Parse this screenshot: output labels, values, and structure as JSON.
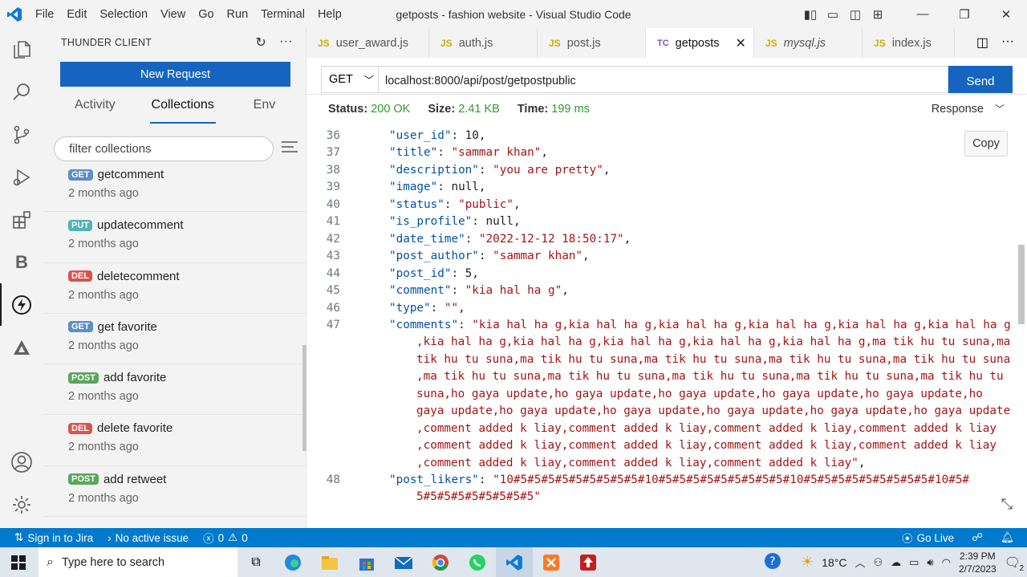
{
  "titlebar": {
    "menu": [
      "File",
      "Edit",
      "Selection",
      "View",
      "Go",
      "Run",
      "Terminal",
      "Help"
    ],
    "title": "getposts - fashion website - Visual Studio Code"
  },
  "activity_bar": [
    "explorer-icon",
    "search-icon",
    "source-control-icon",
    "run-debug-icon",
    "extensions-icon",
    "b-icon",
    "thunder-client-icon",
    "triangle-icon",
    "account-icon",
    "settings-gear-icon"
  ],
  "sidebar": {
    "title": "THUNDER CLIENT",
    "new_request": "New Request",
    "tabs": [
      "Activity",
      "Collections",
      "Env"
    ],
    "filter_placeholder": "filter collections",
    "items": [
      {
        "method": "GET",
        "name": "getcomment",
        "time": "2 months ago"
      },
      {
        "method": "PUT",
        "name": "updatecomment",
        "time": "2 months ago"
      },
      {
        "method": "DEL",
        "name": "deletecomment",
        "time": "2 months ago"
      },
      {
        "method": "GET",
        "name": "get favorite",
        "time": "2 months ago"
      },
      {
        "method": "POST",
        "name": "add favorite",
        "time": "2 months ago"
      },
      {
        "method": "DEL",
        "name": "delete favorite",
        "time": "2 months ago"
      },
      {
        "method": "POST",
        "name": "add retweet",
        "time": "2 months ago"
      }
    ]
  },
  "editor_tabs": [
    {
      "prefix": "JS",
      "label": "user_award.js"
    },
    {
      "prefix": "JS",
      "label": "auth.js"
    },
    {
      "prefix": "JS",
      "label": "post.js"
    },
    {
      "prefix": "TC",
      "label": "getposts"
    },
    {
      "prefix": "JS",
      "label": "mysql.js"
    },
    {
      "prefix": "JS",
      "label": "index.js"
    }
  ],
  "request": {
    "method": "GET",
    "url": "localhost:8000/api/post/getpostpublic",
    "send": "Send"
  },
  "response": {
    "status_label": "Status:",
    "status": "200 OK",
    "size_label": "Size:",
    "size": "2.41 KB",
    "time_label": "Time:",
    "time": "199 ms",
    "view": "Response",
    "copy": "Copy"
  },
  "code_lines": [
    {
      "n": "36",
      "key": "\"user_id\"",
      "val": " 10,",
      "num": true
    },
    {
      "n": "37",
      "key": "\"title\"",
      "val": " \"sammar khan\"",
      "tail": ","
    },
    {
      "n": "38",
      "key": "\"description\"",
      "val": " \"you are pretty\"",
      "tail": ","
    },
    {
      "n": "39",
      "key": "\"image\"",
      "val": " null,",
      "num": true
    },
    {
      "n": "40",
      "key": "\"status\"",
      "val": " \"public\"",
      "tail": ","
    },
    {
      "n": "41",
      "key": "\"is_profile\"",
      "val": " null,",
      "num": true
    },
    {
      "n": "42",
      "key": "\"date_time\"",
      "val": " \"2022-12-12 18:50:17\"",
      "tail": ","
    },
    {
      "n": "43",
      "key": "\"post_author\"",
      "val": " \"sammar khan\"",
      "tail": ","
    },
    {
      "n": "44",
      "key": "\"post_id\"",
      "val": " 5,",
      "num": true
    },
    {
      "n": "45",
      "key": "\"comment\"",
      "val": " \"kia hal ha g\"",
      "tail": ","
    },
    {
      "n": "46",
      "key": "\"type\"",
      "val": " \"\"",
      "tail": ","
    },
    {
      "n": "47",
      "key": "\"comments\"",
      "val": " \"kia hal ha g,kia hal ha g,kia hal ha g,kia hal ha g,kia hal ha g,kia hal ha g"
    },
    {
      "n": "",
      "wrap": ",kia hal ha g,kia hal ha g,kia hal ha g,kia hal ha g,kia hal ha g,ma tik hu tu suna,ma"
    },
    {
      "n": "",
      "wrap": "tik hu tu suna,ma tik hu tu suna,ma tik hu tu suna,ma tik hu tu suna,ma tik hu tu suna"
    },
    {
      "n": "",
      "wrap": ",ma tik hu tu suna,ma tik hu tu suna,ma tik hu tu suna,ma tik hu tu suna,ma tik hu tu"
    },
    {
      "n": "",
      "wrap": "suna,ho gaya update,ho gaya update,ho gaya update,ho gaya update,ho gaya update,ho"
    },
    {
      "n": "",
      "wrap": "gaya update,ho gaya update,ho gaya update,ho gaya update,ho gaya update,ho gaya update"
    },
    {
      "n": "",
      "wrap": ",comment added k liay,comment added k liay,comment added k liay,comment added k liay"
    },
    {
      "n": "",
      "wrap": ",comment added k liay,comment added k liay,comment added k liay,comment added k liay"
    },
    {
      "n": "",
      "wrap": ",comment added k liay,comment added k liay,comment added k liay\"",
      "tail": ","
    },
    {
      "n": "48",
      "key": "\"post_likers\"",
      "val": " \"10#5#5#5#5#5#5#5#5#5#10#5#5#5#5#5#5#5#5#5#10#5#5#5#5#5#5#5#5#5#10#5#"
    },
    {
      "n": "",
      "wrap": "5#5#5#5#5#5#5#5#5\""
    }
  ],
  "statusbar": {
    "jira": "Sign in to Jira",
    "issue": "No active issue",
    "errors": "0",
    "warnings": "0",
    "golive": "Go Live"
  },
  "taskbar": {
    "search": "Type here to search",
    "weather": "18°C",
    "time": "2:39 PM",
    "date": "2/7/2023",
    "notifications": "2"
  }
}
